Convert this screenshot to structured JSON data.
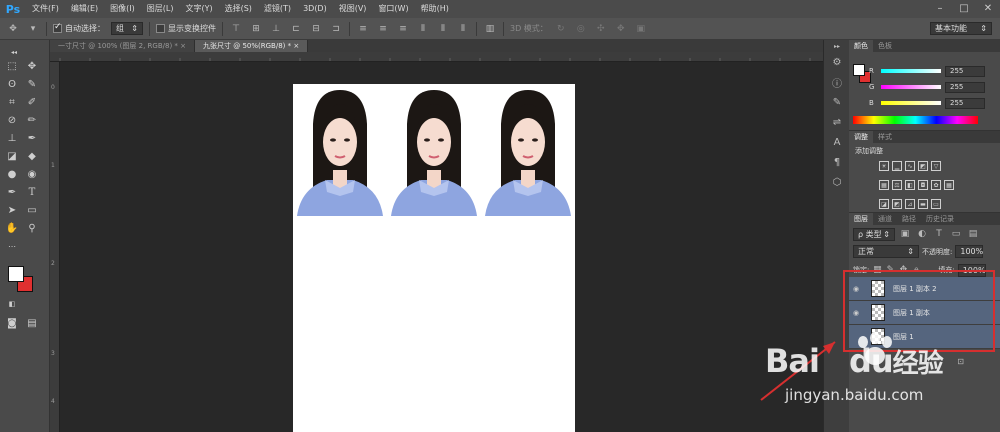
{
  "app": {
    "logo": "Ps"
  },
  "menu": [
    "文件(F)",
    "编辑(E)",
    "图像(I)",
    "图层(L)",
    "文字(Y)",
    "选择(S)",
    "滤镜(T)",
    "3D(D)",
    "视图(V)",
    "窗口(W)",
    "帮助(H)"
  ],
  "options": {
    "auto_select_label": "自动选择：",
    "auto_select_value": "组",
    "show_transform_label": "显示变换控件",
    "mode_3d_label": "3D 模式：",
    "workspace": "基本功能"
  },
  "doc_tabs": [
    {
      "label": "一寸尺寸 @ 100% (图层 2, RGB/8) *",
      "close": "×",
      "active": false
    },
    {
      "label": "九张尺寸 @ 50%(RGB/8) *",
      "close": "×",
      "active": true
    }
  ],
  "ruler_labels": [
    "0",
    "1",
    "2",
    "3",
    "4"
  ],
  "color_panel": {
    "tabs": [
      "颜色",
      "色板"
    ],
    "channels": [
      {
        "label": "R",
        "value": "255",
        "gradient": "#ff3030"
      },
      {
        "label": "G",
        "value": "255",
        "gradient": "#30ff30"
      },
      {
        "label": "B",
        "value": "255",
        "gradient": "#3030ff"
      }
    ]
  },
  "adjust_panel": {
    "tabs": [
      "调整",
      "样式"
    ],
    "title": "添加调整"
  },
  "layers_panel": {
    "tabs": [
      "图层",
      "通道",
      "路径",
      "历史记录"
    ],
    "filter_label": "ρ 类型",
    "blend_mode": "正常",
    "opacity_label": "不透明度:",
    "opacity_value": "100%",
    "lock_label": "锁定:",
    "fill_label": "填充:",
    "fill_value": "100%",
    "layers": [
      {
        "name": "图层 1 副本 2",
        "selected": true
      },
      {
        "name": "图层 1 副本",
        "selected": true
      },
      {
        "name": "图层 1",
        "selected": true
      }
    ]
  },
  "watermark": {
    "brand": "Bai",
    "brand2": "du",
    "suffix": "经验",
    "url": "jingyan.baidu.com"
  },
  "colors": {
    "accent": "#31a8ff",
    "highlight": "#d62f2f",
    "layer_selected": "#55657e",
    "shirt": "#8ea5e0"
  }
}
